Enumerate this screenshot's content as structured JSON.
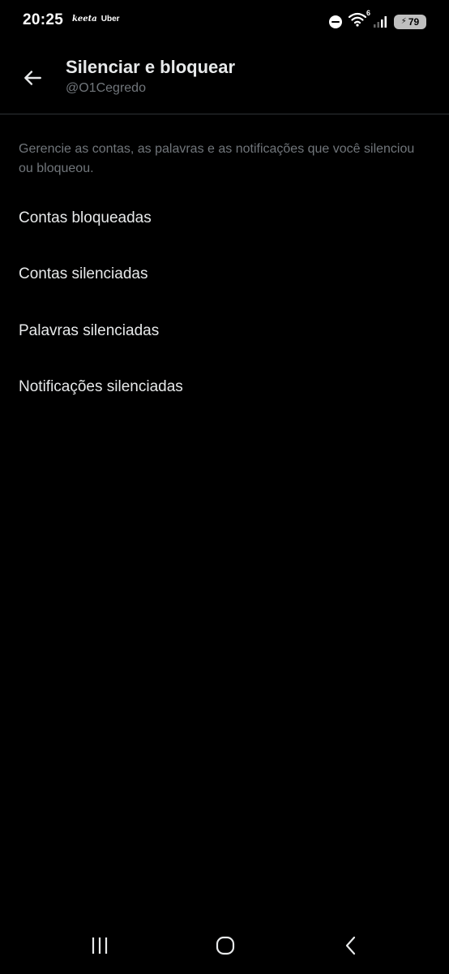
{
  "status_bar": {
    "time": "20:25",
    "apps": [
      "keeta",
      "Uber"
    ],
    "wifi_badge": "6",
    "battery": "79",
    "icons": [
      "do-not-disturb-icon",
      "wifi-icon",
      "signal-icon",
      "battery-icon"
    ]
  },
  "header": {
    "back_icon": "arrow-left-icon",
    "title": "Silenciar e bloquear",
    "subtitle": "@O1Cegredo"
  },
  "description": "Gerencie as contas, as palavras e as notificações que você silenciou ou bloqueou.",
  "menu": {
    "items": [
      {
        "label": "Contas bloqueadas"
      },
      {
        "label": "Contas silenciadas"
      },
      {
        "label": "Palavras silenciadas"
      },
      {
        "label": "Notificações silenciadas"
      }
    ]
  },
  "nav_bar": {
    "icons": [
      "recents-icon",
      "home-icon",
      "back-icon"
    ]
  },
  "colors": {
    "background": "#000000",
    "primary_text": "#e7e9ea",
    "secondary_text": "#71767b",
    "divider": "#2f3336"
  }
}
